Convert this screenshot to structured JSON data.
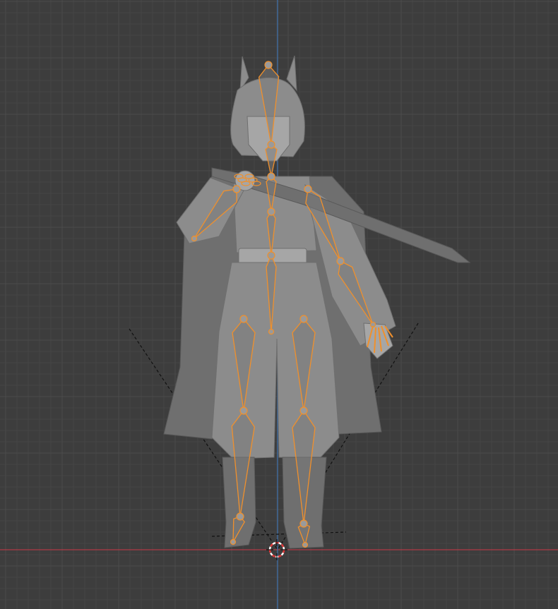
{
  "viewport": {
    "background": "#3d3d3d",
    "grid_minor_color": "#454545",
    "grid_major_color": "#4c4c4c",
    "x_axis_color": "#b03a45",
    "z_axis_color": "#3f6ea5"
  },
  "model": {
    "mesh_color": "#8c8c8c",
    "mesh_shadow_color": "#6f6f6f",
    "mesh_highlight_color": "#a6a6a6"
  },
  "armature": {
    "selected_outline_color": "#f0902c",
    "bone_fill_color": "#7a7a7a",
    "joint_color": "#9a9a9a"
  },
  "icons": {
    "cursor": "3d-cursor-icon",
    "camera": "camera-frustum-icon"
  },
  "cursor_colors": {
    "primary": "#e03a3a",
    "secondary": "#ffffff"
  }
}
